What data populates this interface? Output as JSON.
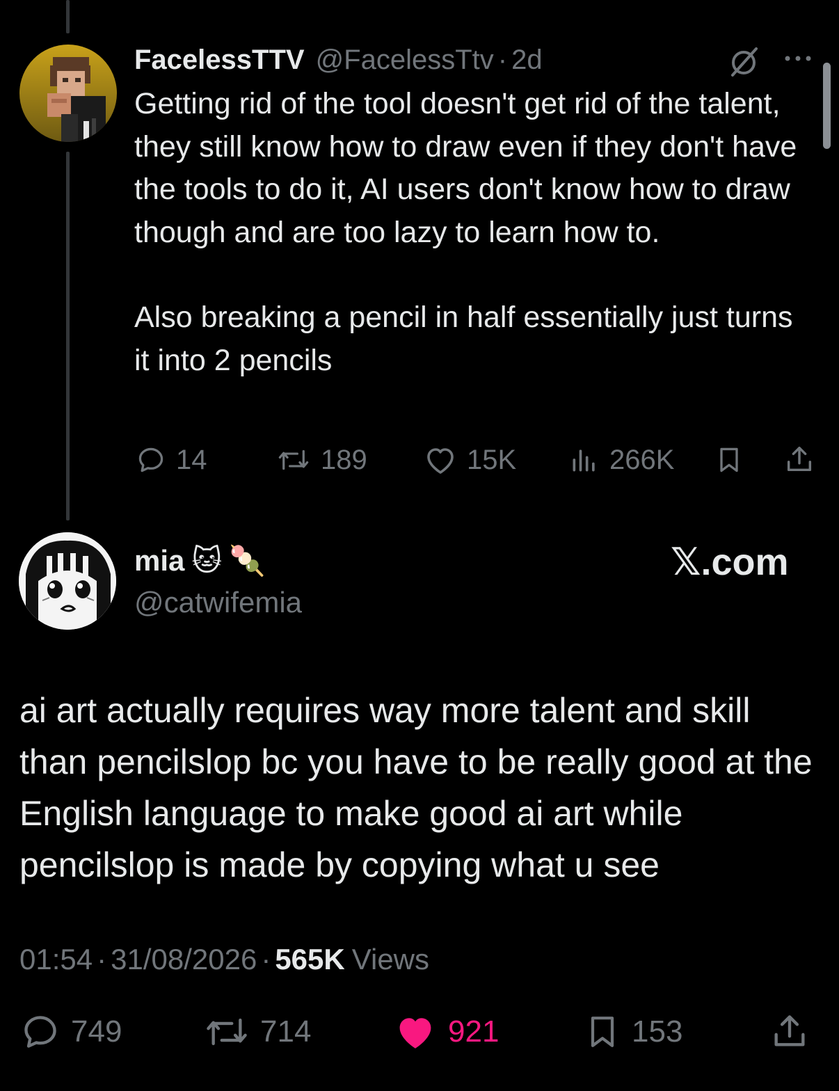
{
  "parent_tweet": {
    "display_name": "FacelessTTV",
    "handle": "@FacelessTtv",
    "separator": "·",
    "time": "2d",
    "text_p1": "Getting rid of the tool doesn't get rid of the talent, they still know how to draw even if they don't have the tools to do it, AI users don't know how to draw though and are too lazy to learn how to.",
    "text_p2": "Also breaking a pencil in half essentially just turns it into 2 pencils",
    "replies": "14",
    "reposts": "189",
    "likes": "15K",
    "views": "266K",
    "avatar_icon": "pixel-art-avatar",
    "grok-icon": "slashed-circle-icon",
    "more-icon": "more-horizontal-icon"
  },
  "main_tweet": {
    "display_name": "mia",
    "emoji": [
      "🐱",
      "🍡"
    ],
    "handle": "@catwifemia",
    "brand": "𝕏.com",
    "text": "ai art actually requires way more talent and skill than pencilslop bc you have to be really good at the English language to make good ai art while pencilslop is made by copying what u see",
    "time": "01:54",
    "date": "31/08/2026",
    "sep1": "·",
    "sep2": "·",
    "views_count": "565K",
    "views_label": "Views",
    "replies": "749",
    "reposts": "714",
    "likes": "921",
    "bookmarks": "153",
    "like_color": "#f91880"
  }
}
